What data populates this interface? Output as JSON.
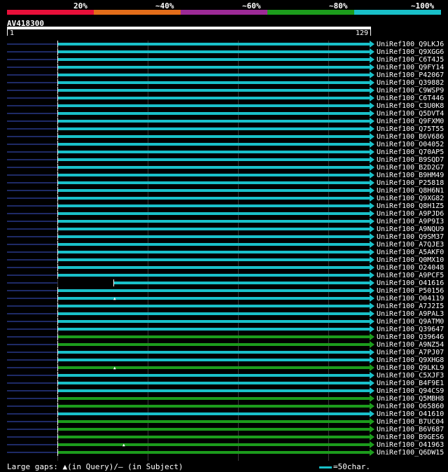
{
  "legend": {
    "labels": [
      "20%",
      "~40%",
      "~60%",
      "~80%",
      "~100%"
    ],
    "colors": [
      "#e8103a",
      "#e26d1a",
      "#9c2a96",
      "#1c9c1c",
      "#19c0c9"
    ]
  },
  "query": {
    "id": "AV418300",
    "start": "1",
    "end": "129"
  },
  "colors": {
    "cyan": "#19c0c9",
    "green": "#1c9c1c",
    "query_pre": "#1e2a66"
  },
  "hits": [
    {
      "label": "UniRef100_Q9LKJ6",
      "color": "cyan",
      "start": 1
    },
    {
      "label": "UniRef100_Q9XGG6",
      "color": "cyan",
      "start": 1
    },
    {
      "label": "UniRef100_C6T4J5",
      "color": "cyan",
      "start": 1
    },
    {
      "label": "UniRef100_Q9FY14",
      "color": "cyan",
      "start": 1
    },
    {
      "label": "UniRef100_P42067",
      "color": "cyan",
      "start": 1
    },
    {
      "label": "UniRef100_Q39882",
      "color": "cyan",
      "start": 1
    },
    {
      "label": "UniRef100_C9WSP9",
      "color": "cyan",
      "start": 1
    },
    {
      "label": "UniRef100_C6T446",
      "color": "cyan",
      "start": 1
    },
    {
      "label": "UniRef100_C3U0K8",
      "color": "cyan",
      "start": 1
    },
    {
      "label": "UniRef100_Q5DVT4",
      "color": "cyan",
      "start": 1
    },
    {
      "label": "UniRef100_Q9FXM0",
      "color": "cyan",
      "start": 1
    },
    {
      "label": "UniRef100_Q75T55",
      "color": "cyan",
      "start": 1
    },
    {
      "label": "UniRef100_B6V686",
      "color": "cyan",
      "start": 1
    },
    {
      "label": "UniRef100_O04052",
      "color": "cyan",
      "start": 1
    },
    {
      "label": "UniRef100_Q70AP5",
      "color": "cyan",
      "start": 1
    },
    {
      "label": "UniRef100_B9SQD7",
      "color": "cyan",
      "start": 1
    },
    {
      "label": "UniRef100_B2D2G7",
      "color": "cyan",
      "start": 1
    },
    {
      "label": "UniRef100_B9HM49",
      "color": "cyan",
      "start": 1
    },
    {
      "label": "UniRef100_P25818",
      "color": "cyan",
      "start": 1
    },
    {
      "label": "UniRef100_Q8H6N1",
      "color": "cyan",
      "start": 1
    },
    {
      "label": "UniRef100_Q9XG82",
      "color": "cyan",
      "start": 1
    },
    {
      "label": "UniRef100_Q8H1Z5",
      "color": "cyan",
      "start": 1
    },
    {
      "label": "UniRef100_A9PJD6",
      "color": "cyan",
      "start": 1
    },
    {
      "label": "UniRef100_A9P9I3",
      "color": "cyan",
      "start": 1
    },
    {
      "label": "UniRef100_A9NQU9",
      "color": "cyan",
      "start": 1
    },
    {
      "label": "UniRef100_Q9SM37",
      "color": "cyan",
      "start": 1
    },
    {
      "label": "UniRef100_A7QJE3",
      "color": "cyan",
      "start": 1
    },
    {
      "label": "UniRef100_A5AKF0",
      "color": "cyan",
      "start": 1
    },
    {
      "label": "UniRef100_Q0MX10",
      "color": "cyan",
      "start": 1
    },
    {
      "label": "UniRef100_O24048",
      "color": "cyan",
      "start": 1
    },
    {
      "label": "UniRef100_A9PCF5",
      "color": "cyan",
      "start": 1
    },
    {
      "label": "UniRef100_O41616",
      "color": "cyan",
      "start": 24,
      "ext": true
    },
    {
      "label": "UniRef100_P50156",
      "color": "cyan",
      "start": 1
    },
    {
      "label": "UniRef100_O04119",
      "color": "cyan",
      "start": 1,
      "gap": 24
    },
    {
      "label": "UniRef100_A7J2I5",
      "color": "cyan",
      "start": 1
    },
    {
      "label": "UniRef100_A9PAL3",
      "color": "cyan",
      "start": 1
    },
    {
      "label": "UniRef100_Q9ATM0",
      "color": "cyan",
      "start": 1
    },
    {
      "label": "UniRef100_Q39647",
      "color": "cyan",
      "start": 1
    },
    {
      "label": "UniRef100_Q39646",
      "color": "green",
      "start": 1
    },
    {
      "label": "UniRef100_A9NZ54",
      "color": "green",
      "start": 1
    },
    {
      "label": "UniRef100_A7PJ07",
      "color": "cyan",
      "start": 1
    },
    {
      "label": "UniRef100_Q9XHG8",
      "color": "cyan",
      "start": 1
    },
    {
      "label": "UniRef100_Q9LKL9",
      "color": "green",
      "start": 1,
      "gap": 24
    },
    {
      "label": "UniRef100_C5XJF3",
      "color": "cyan",
      "start": 1
    },
    {
      "label": "UniRef100_B4F9E1",
      "color": "cyan",
      "start": 1
    },
    {
      "label": "UniRef100_Q94CS9",
      "color": "cyan",
      "start": 1
    },
    {
      "label": "UniRef100_Q5MBH8",
      "color": "green",
      "start": 1
    },
    {
      "label": "UniRef100_O65860",
      "color": "green",
      "start": 1
    },
    {
      "label": "UniRef100_O41610",
      "color": "cyan",
      "start": 1
    },
    {
      "label": "UniRef100_B7UC04",
      "color": "green",
      "start": 1
    },
    {
      "label": "UniRef100_B6V687",
      "color": "green",
      "start": 1
    },
    {
      "label": "UniRef100_B9GES6",
      "color": "green",
      "start": 1
    },
    {
      "label": "UniRef100_O41963",
      "color": "green",
      "start": 1,
      "gap": 28
    },
    {
      "label": "UniRef100_Q6DW15",
      "color": "green",
      "start": 1
    }
  ],
  "footer": {
    "text": "Large gaps: ▲(in Query)/– (in Subject)",
    "scale": "=50char."
  }
}
